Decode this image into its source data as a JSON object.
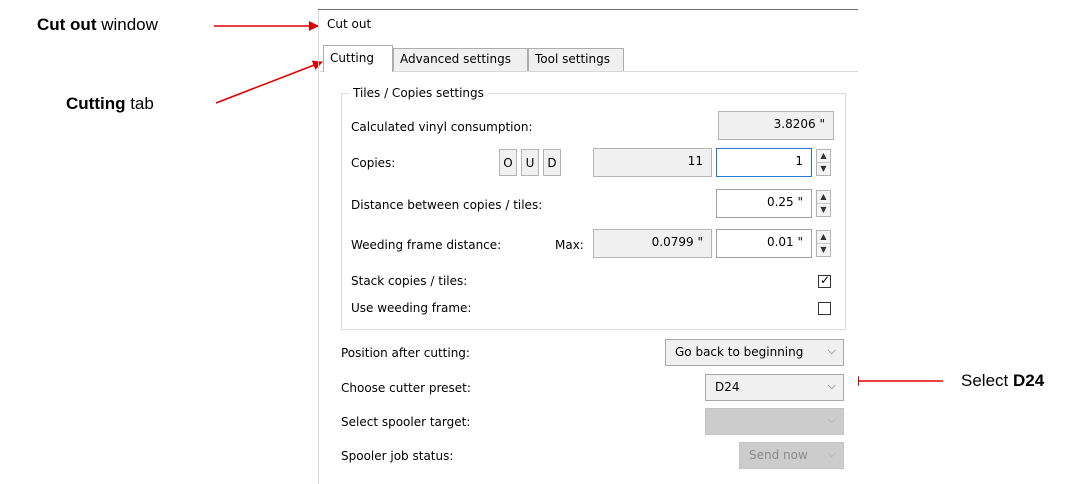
{
  "annotations": {
    "window": {
      "bold": "Cut out",
      "rest": " window"
    },
    "tab": {
      "bold": "Cutting",
      "rest": " tab"
    },
    "select": {
      "prefix": "Select ",
      "bold": "D24"
    },
    "arrow_color": "#e00000"
  },
  "window": {
    "title": "Cut out"
  },
  "tabs": [
    {
      "label": "Cutting",
      "active": true
    },
    {
      "label": "Advanced settings",
      "active": false
    },
    {
      "label": "Tool settings",
      "active": false
    }
  ],
  "group": {
    "legend": "Tiles / Copies settings",
    "vinyl": {
      "label": "Calculated vinyl consumption:",
      "value": "3.8206 \""
    },
    "copies": {
      "label": "Copies:",
      "buttons": [
        "O",
        "U",
        "D"
      ],
      "computed": "11",
      "value": "1"
    },
    "distance": {
      "label": "Distance between copies / tiles:",
      "value": "0.25 \""
    },
    "weeding_distance": {
      "label": "Weeding frame distance:",
      "max_label": "Max:",
      "max_value": "0.0799 \"",
      "value": "0.01 \""
    },
    "stack": {
      "label": "Stack copies / tiles:",
      "checked": true
    },
    "use_weeding": {
      "label": "Use weeding frame:",
      "checked": false
    }
  },
  "position_after": {
    "label": "Position after cutting:",
    "value": "Go back to beginning"
  },
  "cutter_preset": {
    "label": "Choose cutter preset:",
    "value": "D24"
  },
  "spooler_target": {
    "label": "Select spooler target:",
    "value": ""
  },
  "spooler_status": {
    "label": "Spooler job status:",
    "value": "Send now"
  },
  "icons": {
    "check": "✓",
    "chevron": "⌵",
    "spin_up": "▲",
    "spin_down": "▼"
  }
}
